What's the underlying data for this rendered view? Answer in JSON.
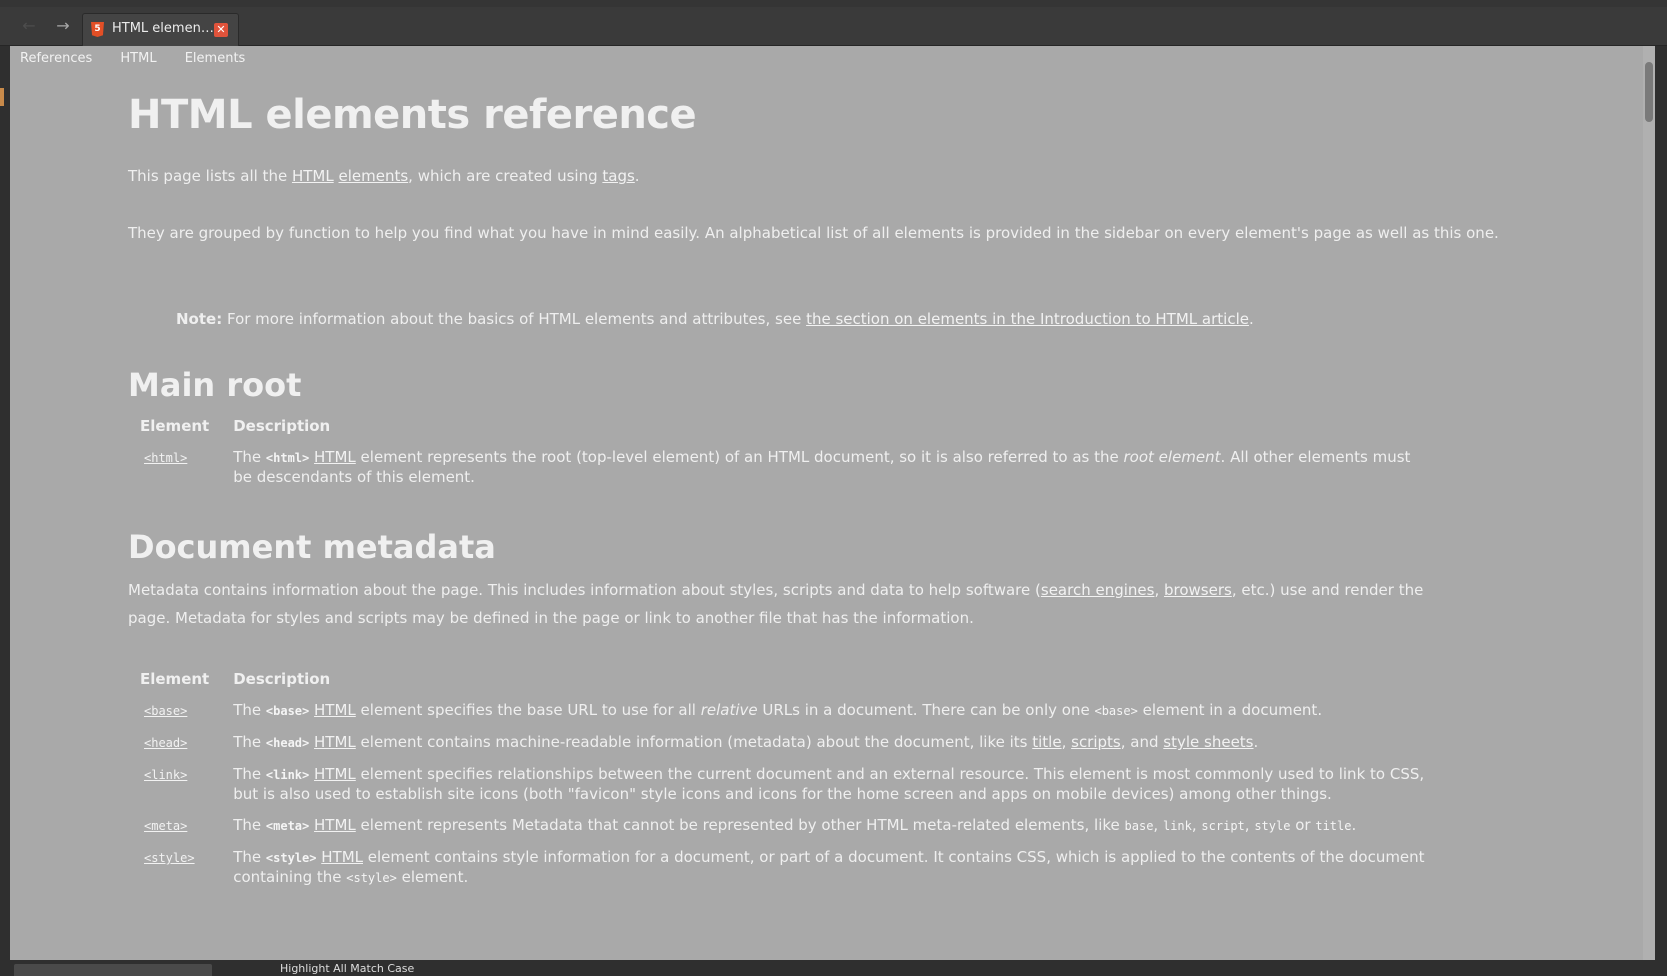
{
  "tab": {
    "title": "HTML elemen…"
  },
  "breadcrumbs": [
    "References",
    "HTML",
    "Elements"
  ],
  "heading": "HTML elements reference",
  "intro": {
    "pre": "This page lists all the ",
    "link1": "HTML",
    "link2": "elements",
    "mid": ", which are created using ",
    "link3": "tags",
    "post": "."
  },
  "intro2": "They are grouped by function to help you find what you have in mind easily. An alphabetical list of all elements is provided in the sidebar on every element's page as well as this one.",
  "note": {
    "label": "Note:",
    "text": " For more information about the basics of HTML elements and attributes, see ",
    "link": "the section on elements in the Introduction to HTML article",
    "post": "."
  },
  "table_headers": {
    "element": "Element",
    "description": "Description"
  },
  "main_root": {
    "title": "Main root",
    "rows": [
      {
        "tag": "<html>",
        "desc_pre": "The ",
        "code": "<html>",
        "link": "HTML",
        "desc_a": " element represents the root (top-level element) of an HTML document, so it is also referred to as the ",
        "em": "root element",
        "desc_b": ". All other elements must be descendants of this element."
      }
    ]
  },
  "metadata": {
    "title": "Document metadata",
    "intro_pre": "Metadata contains information about the page. This includes information about styles, scripts and data to help software (",
    "link_search": "search engines",
    "link_browsers": "browsers",
    "intro_post": ", etc.) use and render the page. Metadata for styles and scripts may be defined in the page or link to another file that has the information.",
    "rows": {
      "base": {
        "tag": "<base>",
        "code": "<base>",
        "link": "HTML",
        "a": " element specifies the base URL to use for all ",
        "em": "relative",
        "b": " URLs in a document. There can be only one ",
        "code2": "<base>",
        "c": " element in a document."
      },
      "head": {
        "tag": "<head>",
        "code": "<head>",
        "link": "HTML",
        "a": " element contains machine-readable information (metadata) about the document, like its ",
        "l1": "title",
        "l2": "scripts",
        "mid": ", and ",
        "l3": "style sheets",
        "b": "."
      },
      "link": {
        "tag": "<link>",
        "code": "<link>",
        "link": "HTML",
        "a": " element specifies relationships between the current document and an external resource. This element is most commonly used to link to CSS, but is also used to establish site icons (both \"favicon\" style icons and icons for the home screen and apps on mobile devices) among other things."
      },
      "meta": {
        "tag": "<meta>",
        "code": "<meta>",
        "link": "HTML",
        "a": " element represents Metadata that cannot be represented by other HTML meta-related elements, like ",
        "c1": "base",
        "c2": "link",
        "c3": "script",
        "c4": "style",
        "or": " or ",
        "c5": "title"
      },
      "style": {
        "tag": "<style>",
        "code": "<style>",
        "link": "HTML",
        "a": " element contains style information for a document, or part of a document. It contains CSS, which is applied to the contents of the document containing the ",
        "code2": "<style>",
        "b": " element."
      }
    }
  },
  "status": {
    "text": "Highlight All   Match Case"
  }
}
